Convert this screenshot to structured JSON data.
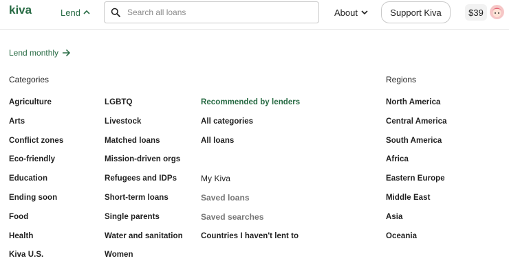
{
  "header": {
    "logo_text": "kiva",
    "lend_label": "Lend",
    "search_placeholder": "Search all loans",
    "about_label": "About",
    "support_label": "Support Kiva",
    "balance": "$39"
  },
  "lend_monthly": "Lend monthly",
  "categories_heading": "Categories",
  "regions_heading": "Regions",
  "categories_col1": [
    "Agriculture",
    "Arts",
    "Conflict zones",
    "Eco-friendly",
    "Education",
    "Ending soon",
    "Food",
    "Health",
    "Kiva U.S."
  ],
  "categories_col2": [
    "LGBTQ",
    "Livestock",
    "Matched loans",
    "Mission-driven orgs",
    "Refugees and IDPs",
    "Short-term loans",
    "Single parents",
    "Water and sanitation",
    "Women"
  ],
  "col3": {
    "recommended": "Recommended by lenders",
    "all_categories": "All categories",
    "all_loans": "All loans",
    "my_kiva_heading": "My Kiva",
    "saved_loans": "Saved loans",
    "saved_searches": "Saved searches",
    "countries_not_lent": "Countries I haven't lent to"
  },
  "regions": [
    "North America",
    "Central America",
    "South America",
    "Africa",
    "Eastern Europe",
    "Middle East",
    "Asia",
    "Oceania"
  ],
  "colors": {
    "brand_green": "#276a43",
    "muted_text": "#757575"
  }
}
